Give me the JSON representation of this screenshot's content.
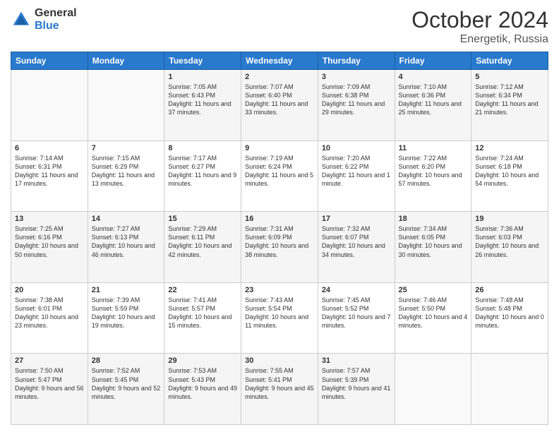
{
  "logo": {
    "general": "General",
    "blue": "Blue"
  },
  "header": {
    "month": "October 2024",
    "location": "Energetik, Russia"
  },
  "weekdays": [
    "Sunday",
    "Monday",
    "Tuesday",
    "Wednesday",
    "Thursday",
    "Friday",
    "Saturday"
  ],
  "weeks": [
    [
      {
        "day": "",
        "content": ""
      },
      {
        "day": "",
        "content": ""
      },
      {
        "day": "1",
        "content": "Sunrise: 7:05 AM\nSunset: 6:43 PM\nDaylight: 11 hours and 37 minutes."
      },
      {
        "day": "2",
        "content": "Sunrise: 7:07 AM\nSunset: 6:40 PM\nDaylight: 11 hours and 33 minutes."
      },
      {
        "day": "3",
        "content": "Sunrise: 7:09 AM\nSunset: 6:38 PM\nDaylight: 11 hours and 29 minutes."
      },
      {
        "day": "4",
        "content": "Sunrise: 7:10 AM\nSunset: 6:36 PM\nDaylight: 11 hours and 25 minutes."
      },
      {
        "day": "5",
        "content": "Sunrise: 7:12 AM\nSunset: 6:34 PM\nDaylight: 11 hours and 21 minutes."
      }
    ],
    [
      {
        "day": "6",
        "content": "Sunrise: 7:14 AM\nSunset: 6:31 PM\nDaylight: 11 hours and 17 minutes."
      },
      {
        "day": "7",
        "content": "Sunrise: 7:15 AM\nSunset: 6:29 PM\nDaylight: 11 hours and 13 minutes."
      },
      {
        "day": "8",
        "content": "Sunrise: 7:17 AM\nSunset: 6:27 PM\nDaylight: 11 hours and 9 minutes."
      },
      {
        "day": "9",
        "content": "Sunrise: 7:19 AM\nSunset: 6:24 PM\nDaylight: 11 hours and 5 minutes."
      },
      {
        "day": "10",
        "content": "Sunrise: 7:20 AM\nSunset: 6:22 PM\nDaylight: 11 hours and 1 minute."
      },
      {
        "day": "11",
        "content": "Sunrise: 7:22 AM\nSunset: 6:20 PM\nDaylight: 10 hours and 57 minutes."
      },
      {
        "day": "12",
        "content": "Sunrise: 7:24 AM\nSunset: 6:18 PM\nDaylight: 10 hours and 54 minutes."
      }
    ],
    [
      {
        "day": "13",
        "content": "Sunrise: 7:25 AM\nSunset: 6:16 PM\nDaylight: 10 hours and 50 minutes."
      },
      {
        "day": "14",
        "content": "Sunrise: 7:27 AM\nSunset: 6:13 PM\nDaylight: 10 hours and 46 minutes."
      },
      {
        "day": "15",
        "content": "Sunrise: 7:29 AM\nSunset: 6:11 PM\nDaylight: 10 hours and 42 minutes."
      },
      {
        "day": "16",
        "content": "Sunrise: 7:31 AM\nSunset: 6:09 PM\nDaylight: 10 hours and 38 minutes."
      },
      {
        "day": "17",
        "content": "Sunrise: 7:32 AM\nSunset: 6:07 PM\nDaylight: 10 hours and 34 minutes."
      },
      {
        "day": "18",
        "content": "Sunrise: 7:34 AM\nSunset: 6:05 PM\nDaylight: 10 hours and 30 minutes."
      },
      {
        "day": "19",
        "content": "Sunrise: 7:36 AM\nSunset: 6:03 PM\nDaylight: 10 hours and 26 minutes."
      }
    ],
    [
      {
        "day": "20",
        "content": "Sunrise: 7:38 AM\nSunset: 6:01 PM\nDaylight: 10 hours and 23 minutes."
      },
      {
        "day": "21",
        "content": "Sunrise: 7:39 AM\nSunset: 5:59 PM\nDaylight: 10 hours and 19 minutes."
      },
      {
        "day": "22",
        "content": "Sunrise: 7:41 AM\nSunset: 5:57 PM\nDaylight: 10 hours and 15 minutes."
      },
      {
        "day": "23",
        "content": "Sunrise: 7:43 AM\nSunset: 5:54 PM\nDaylight: 10 hours and 11 minutes."
      },
      {
        "day": "24",
        "content": "Sunrise: 7:45 AM\nSunset: 5:52 PM\nDaylight: 10 hours and 7 minutes."
      },
      {
        "day": "25",
        "content": "Sunrise: 7:46 AM\nSunset: 5:50 PM\nDaylight: 10 hours and 4 minutes."
      },
      {
        "day": "26",
        "content": "Sunrise: 7:48 AM\nSunset: 5:48 PM\nDaylight: 10 hours and 0 minutes."
      }
    ],
    [
      {
        "day": "27",
        "content": "Sunrise: 7:50 AM\nSunset: 5:47 PM\nDaylight: 9 hours and 56 minutes."
      },
      {
        "day": "28",
        "content": "Sunrise: 7:52 AM\nSunset: 5:45 PM\nDaylight: 9 hours and 52 minutes."
      },
      {
        "day": "29",
        "content": "Sunrise: 7:53 AM\nSunset: 5:43 PM\nDaylight: 9 hours and 49 minutes."
      },
      {
        "day": "30",
        "content": "Sunrise: 7:55 AM\nSunset: 5:41 PM\nDaylight: 9 hours and 45 minutes."
      },
      {
        "day": "31",
        "content": "Sunrise: 7:57 AM\nSunset: 5:39 PM\nDaylight: 9 hours and 41 minutes."
      },
      {
        "day": "",
        "content": ""
      },
      {
        "day": "",
        "content": ""
      }
    ]
  ]
}
